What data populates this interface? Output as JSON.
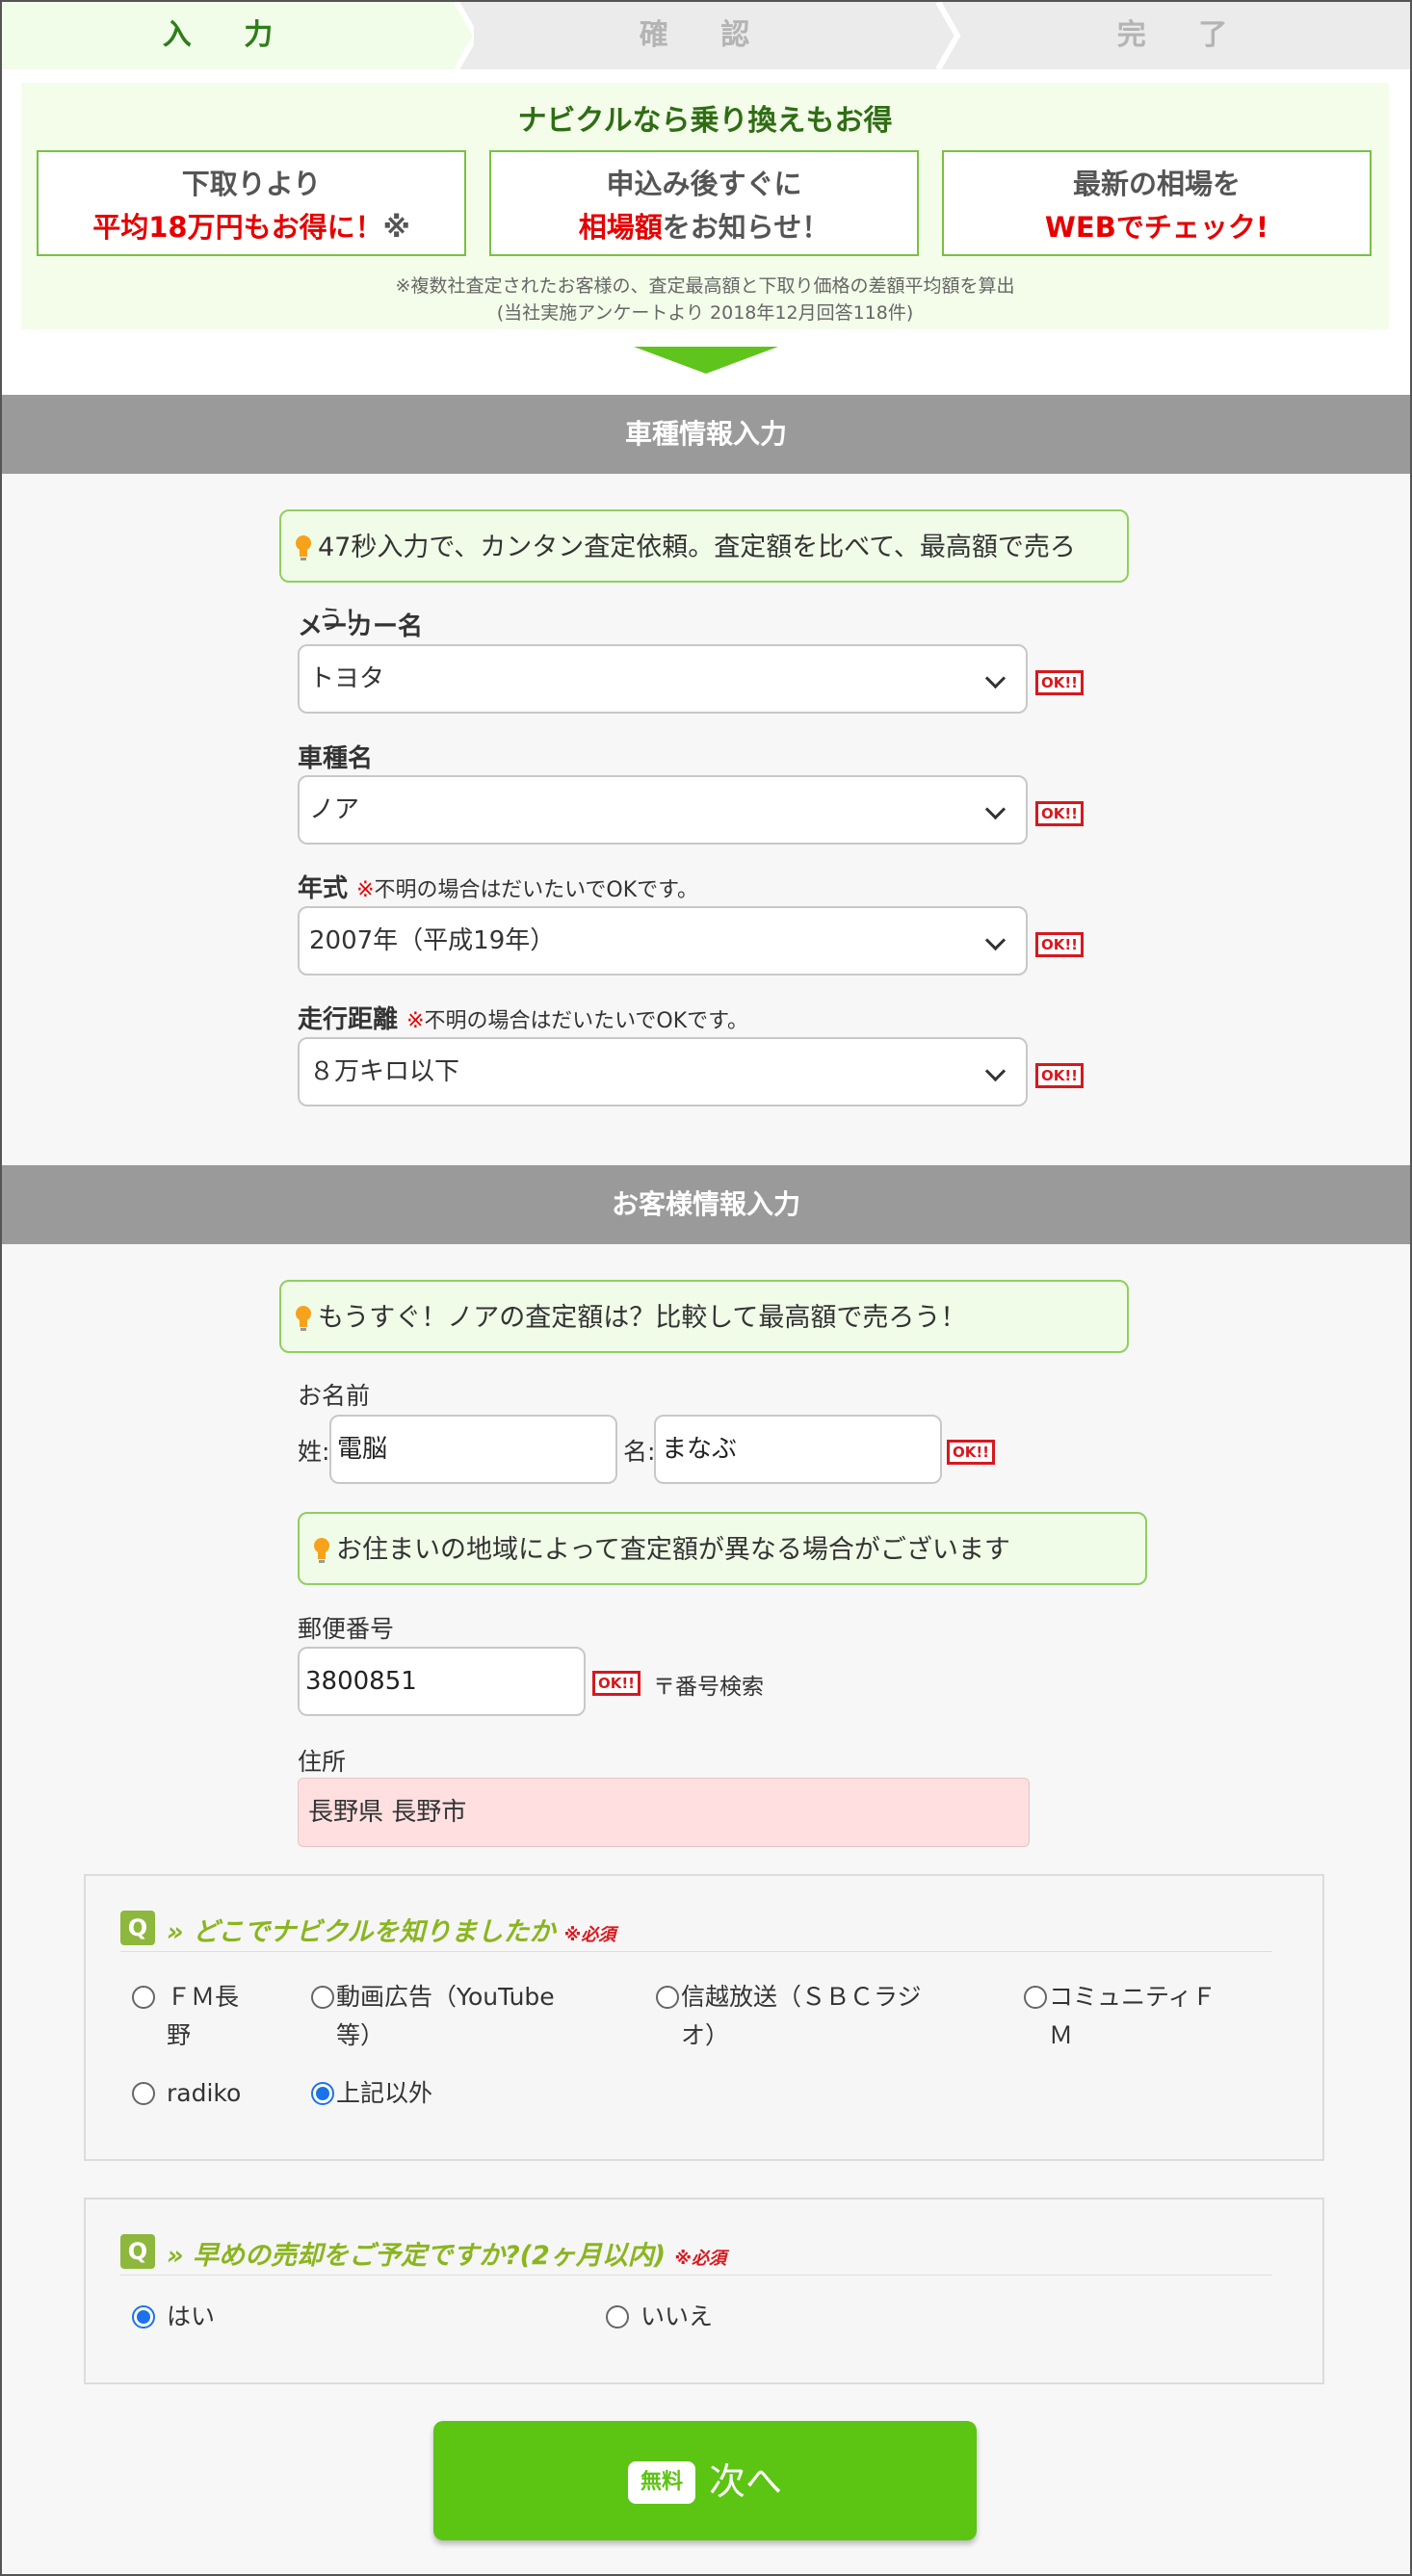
{
  "steps": [
    "入 力",
    "確 認",
    "完 了"
  ],
  "promo": {
    "title": "ナビクルなら乗り換えもお得",
    "boxes": [
      {
        "line1": "下取りより",
        "line2_red": "平均18万円もお得に！",
        "line2_rest": "※"
      },
      {
        "line1": "申込み後すぐに",
        "line2_red": "相場額",
        "line2_rest": "をお知らせ！"
      },
      {
        "line1": "最新の相場を",
        "line2_red": "WEBでチェック!",
        "line2_rest": ""
      }
    ],
    "note1": "※複数社査定されたお客様の、査定最高額と下取り価格の差額平均額を算出",
    "note2": "(当社実施アンケートより 2018年12月回答118件)"
  },
  "vehicle": {
    "header": "車種情報入力",
    "tip": "47秒入力で、カンタン査定依頼。査定額を比べて、最高額で売ろう！",
    "ok_badge": "OK!!",
    "maker": {
      "label": "メーカー名",
      "value": "トヨタ"
    },
    "model": {
      "label": "車種名",
      "value": "ノア"
    },
    "year": {
      "label": "年式",
      "note_mark": "※",
      "note": "不明の場合はだいたいでOKです。",
      "value": "2007年（平成19年）"
    },
    "mileage": {
      "label": "走行距離",
      "note_mark": "※",
      "note": "不明の場合はだいたいでOKです。",
      "value": "８万キロ以下"
    }
  },
  "customer": {
    "header": "お客様情報入力",
    "tip": "もうすぐ！ノアの査定額は？比較して最高額で売ろう！",
    "name_label": "お名前",
    "last_label": "姓:",
    "last_value": "電脳",
    "first_label": "名:",
    "first_value": "まなぶ",
    "tip2": "お住まいの地域によって査定額が異なる場合がございます",
    "zip_label": "郵便番号",
    "zip_value": "3800851",
    "zip_search": "〒番号検索",
    "addr_label": "住所",
    "addr_value": "長野県 長野市"
  },
  "survey1": {
    "icon": "Q",
    "title": "» どこでナビクルを知りましたか",
    "required": "※必須",
    "options": [
      {
        "line1": "ＦＭ長",
        "line2": "野",
        "selected": false
      },
      {
        "line1": "動画広告（YouTube",
        "line2": "等）",
        "selected": false
      },
      {
        "line1": "信越放送（ＳＢＣラジ",
        "line2": "オ）",
        "selected": false
      },
      {
        "line1": "コミュニティＦ",
        "line2": "Ｍ",
        "selected": false
      },
      {
        "line1": "radiko",
        "line2": "",
        "selected": false
      },
      {
        "line1": "上記以外",
        "line2": "",
        "selected": true
      }
    ]
  },
  "survey2": {
    "icon": "Q",
    "title": "» 早めの売却をご予定ですか?(2ヶ月以内)",
    "required": "※必須",
    "options": [
      {
        "line1": "はい",
        "selected": true
      },
      {
        "line1": "いいえ",
        "selected": false
      }
    ]
  },
  "next_button": {
    "badge": "無料",
    "label": "次へ"
  },
  "colors": {
    "brand_green": "#5cc413",
    "accent_red": "#e60000",
    "section_gray": "#9a9a9a"
  }
}
